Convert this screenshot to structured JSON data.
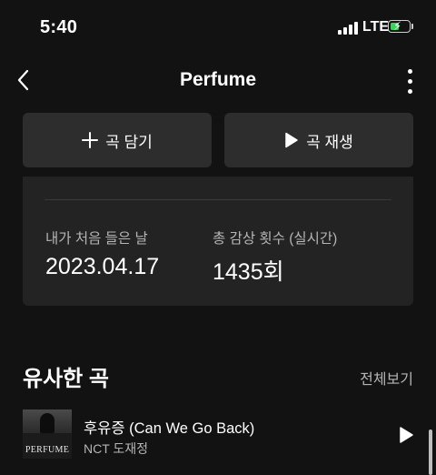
{
  "status": {
    "time": "5:40",
    "network": "LTE"
  },
  "nav": {
    "title": "Perfume"
  },
  "actions": {
    "add_label": "곡 담기",
    "play_label": "곡 재생"
  },
  "stats": {
    "first_listen_label": "내가 처음 들은 날",
    "first_listen_value": "2023.04.17",
    "play_count_label": "총 감상 횟수 (실시간)",
    "play_count_value": "1435회"
  },
  "similar": {
    "title": "유사한 곡",
    "see_all": "전체보기",
    "tracks": [
      {
        "title": "후유증 (Can We Go Back)",
        "artist": "NCT 도재정",
        "cover_text": "PERFUME"
      }
    ]
  },
  "colors": {
    "background": "#121212",
    "button": "#2d2d2d",
    "card": "#232323",
    "battery": "#3ad25a"
  },
  "icons": [
    "signal-icon",
    "battery-icon",
    "back-icon",
    "more-icon",
    "plus-icon",
    "play-icon"
  ]
}
